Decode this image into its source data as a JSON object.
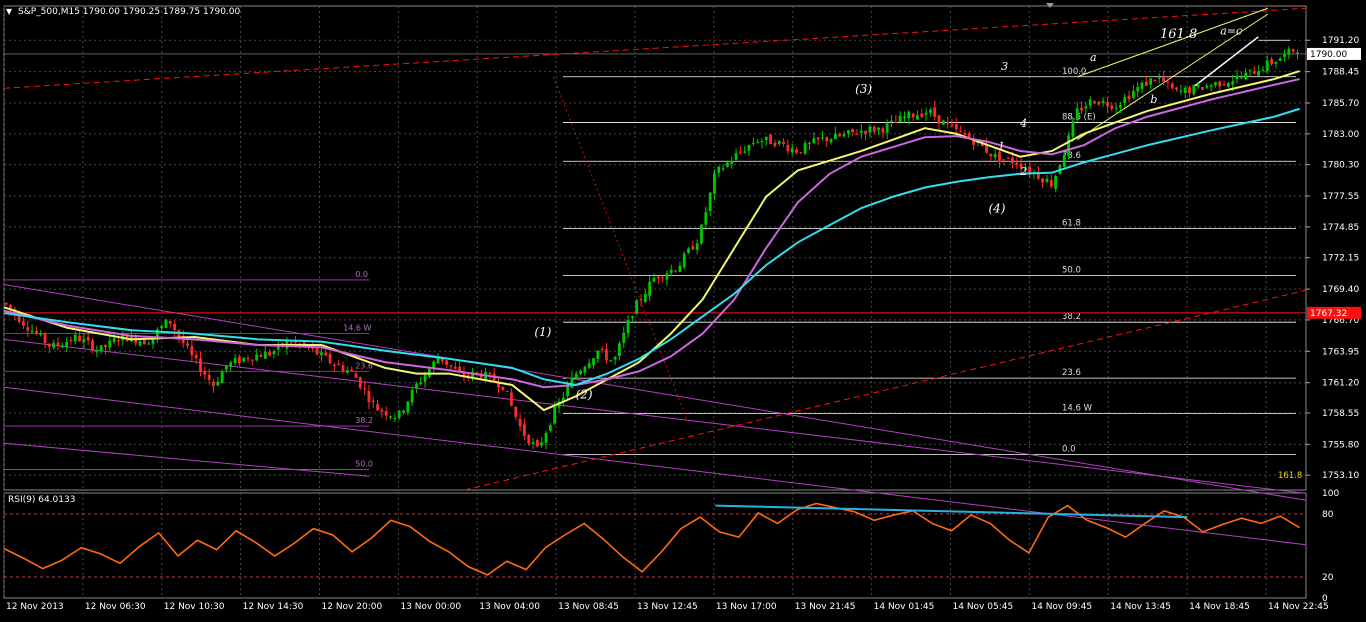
{
  "window": {
    "header_text": "S&P_500,M15  1790.00 1790.25 1789.75 1790.00",
    "rsi_header": "RSI(9) 64.0133"
  },
  "chart_data": {
    "type": "line",
    "instrument": "S&P_500",
    "timeframe": "M15",
    "ohlc": {
      "open": 1790.0,
      "high": 1790.25,
      "low": 1789.75,
      "close": 1790.0
    },
    "current_price": 1790.0,
    "horizontal_line_price": 1767.32,
    "ylim": [
      1751.8,
      1794.2
    ],
    "y_ticks": [
      1791.2,
      1788.45,
      1785.7,
      1783.0,
      1780.3,
      1777.55,
      1774.85,
      1772.15,
      1769.4,
      1766.7,
      1763.95,
      1761.2,
      1758.55,
      1755.8,
      1753.1
    ],
    "x_ticks": [
      "12 Nov 2013",
      "12 Nov 06:30",
      "12 Nov 10:30",
      "12 Nov 14:30",
      "12 Nov 20:00",
      "13 Nov 00:00",
      "13 Nov 04:00",
      "13 Nov 08:45",
      "13 Nov 12:45",
      "13 Nov 17:00",
      "13 Nov 21:45",
      "14 Nov 01:45",
      "14 Nov 05:45",
      "14 Nov 09:45",
      "14 Nov 13:45",
      "14 Nov 18:45",
      "14 Nov 22:45"
    ],
    "series": [
      {
        "name": "price",
        "points": [
          [
            0,
            1768.2
          ],
          [
            0.6,
            1766.5
          ],
          [
            1.5,
            1764.3
          ],
          [
            2.3,
            1765.2
          ],
          [
            3,
            1764.0
          ],
          [
            3.7,
            1765.3
          ],
          [
            4.5,
            1764.8
          ],
          [
            5.2,
            1766.7
          ],
          [
            5.9,
            1763.5
          ],
          [
            6.6,
            1761.0
          ],
          [
            7,
            1762.7
          ],
          [
            7.7,
            1763.5
          ],
          [
            8.4,
            1763.8
          ],
          [
            9,
            1764.8
          ],
          [
            9.6,
            1764.2
          ],
          [
            10.3,
            1763.0
          ],
          [
            11,
            1762.0
          ],
          [
            11.7,
            1759.0
          ],
          [
            12.4,
            1758.2
          ],
          [
            13,
            1761.0
          ],
          [
            13.7,
            1763.5
          ],
          [
            14.4,
            1761.8
          ],
          [
            15,
            1762.0
          ],
          [
            15.7,
            1761.0
          ],
          [
            16.3,
            1757.0
          ],
          [
            16.8,
            1755.3
          ],
          [
            17.3,
            1758.5
          ],
          [
            18,
            1762.0
          ],
          [
            18.7,
            1764.0
          ],
          [
            19.2,
            1763.0
          ],
          [
            19.8,
            1767.5
          ],
          [
            20.5,
            1770.5
          ],
          [
            21.2,
            1771.3
          ],
          [
            21.9,
            1774.0
          ],
          [
            22.4,
            1779.5
          ],
          [
            23,
            1781.0
          ],
          [
            23.7,
            1782.5
          ],
          [
            24.3,
            1782.3
          ],
          [
            25,
            1781.5
          ],
          [
            25.7,
            1782.5
          ],
          [
            26.4,
            1782.8
          ],
          [
            27,
            1783.3
          ],
          [
            27.7,
            1783.5
          ],
          [
            28.4,
            1784.5
          ],
          [
            29.1,
            1785.0
          ],
          [
            29.8,
            1783.5
          ],
          [
            30.5,
            1782.5
          ],
          [
            31.2,
            1781.0
          ],
          [
            31.9,
            1780.5
          ],
          [
            32.5,
            1779.5
          ],
          [
            33.0,
            1778.6
          ],
          [
            33.4,
            1781.5
          ],
          [
            33.8,
            1785.0
          ],
          [
            34.3,
            1786.0
          ],
          [
            35,
            1785.5
          ],
          [
            35.7,
            1787.0
          ],
          [
            36.3,
            1788.0
          ],
          [
            36.9,
            1786.6
          ],
          [
            37.6,
            1787.0
          ],
          [
            38.3,
            1787.5
          ],
          [
            39,
            1788.0
          ],
          [
            39.7,
            1789.0
          ],
          [
            40.3,
            1789.8
          ],
          [
            40.7,
            1790.5
          ]
        ]
      },
      {
        "name": "MA fast (yellow)",
        "points": [
          [
            0,
            1767.8
          ],
          [
            2,
            1766.0
          ],
          [
            4,
            1765.0
          ],
          [
            6,
            1765.2
          ],
          [
            8,
            1764.5
          ],
          [
            10,
            1764.5
          ],
          [
            12,
            1762.5
          ],
          [
            13,
            1762.0
          ],
          [
            14,
            1762.0
          ],
          [
            16,
            1761.0
          ],
          [
            17,
            1758.8
          ],
          [
            18,
            1760.0
          ],
          [
            19,
            1761.5
          ],
          [
            20,
            1763.0
          ],
          [
            21,
            1765.5
          ],
          [
            22,
            1768.5
          ],
          [
            23,
            1773.0
          ],
          [
            24,
            1777.5
          ],
          [
            25,
            1779.8
          ],
          [
            27,
            1781.5
          ],
          [
            29,
            1783.5
          ],
          [
            30,
            1783.0
          ],
          [
            31,
            1782.0
          ],
          [
            32,
            1781.0
          ],
          [
            33,
            1781.5
          ],
          [
            34,
            1783.0
          ],
          [
            36,
            1785.0
          ],
          [
            38,
            1786.5
          ],
          [
            40,
            1787.8
          ],
          [
            40.8,
            1788.5
          ]
        ]
      },
      {
        "name": "MA mid (violet)",
        "points": [
          [
            0,
            1767.5
          ],
          [
            2,
            1766.2
          ],
          [
            4,
            1765.3
          ],
          [
            6,
            1765.0
          ],
          [
            8,
            1764.5
          ],
          [
            10,
            1764.3
          ],
          [
            12,
            1763.0
          ],
          [
            14,
            1762.3
          ],
          [
            16,
            1761.5
          ],
          [
            17,
            1760.8
          ],
          [
            18,
            1761.0
          ],
          [
            19,
            1761.5
          ],
          [
            20,
            1762.2
          ],
          [
            21,
            1763.5
          ],
          [
            22,
            1765.5
          ],
          [
            23,
            1768.5
          ],
          [
            24,
            1773.0
          ],
          [
            25,
            1777.0
          ],
          [
            26,
            1779.5
          ],
          [
            27,
            1781.0
          ],
          [
            29,
            1782.7
          ],
          [
            30,
            1782.8
          ],
          [
            31,
            1782.3
          ],
          [
            32,
            1781.5
          ],
          [
            33,
            1781.2
          ],
          [
            34,
            1782.0
          ],
          [
            35,
            1783.5
          ],
          [
            36,
            1784.5
          ],
          [
            38,
            1786.0
          ],
          [
            40,
            1787.3
          ],
          [
            40.8,
            1787.8
          ]
        ]
      },
      {
        "name": "MA slow (cyan)",
        "points": [
          [
            0,
            1767.3
          ],
          [
            2,
            1766.5
          ],
          [
            4,
            1765.8
          ],
          [
            6,
            1765.5
          ],
          [
            8,
            1765.0
          ],
          [
            10,
            1764.8
          ],
          [
            12,
            1764.0
          ],
          [
            14,
            1763.3
          ],
          [
            16,
            1762.5
          ],
          [
            17,
            1761.5
          ],
          [
            18,
            1761.0
          ],
          [
            19,
            1762.0
          ],
          [
            20,
            1763.3
          ],
          [
            21,
            1765.0
          ],
          [
            22,
            1767.0
          ],
          [
            23,
            1769.0
          ],
          [
            24,
            1771.5
          ],
          [
            25,
            1773.5
          ],
          [
            26,
            1775.0
          ],
          [
            27,
            1776.5
          ],
          [
            28,
            1777.5
          ],
          [
            29,
            1778.3
          ],
          [
            30,
            1778.8
          ],
          [
            31,
            1779.2
          ],
          [
            32,
            1779.5
          ],
          [
            33,
            1779.6
          ],
          [
            34,
            1780.5
          ],
          [
            36,
            1782.0
          ],
          [
            38,
            1783.3
          ],
          [
            40,
            1784.5
          ],
          [
            40.8,
            1785.2
          ]
        ]
      }
    ],
    "fibonacci_levels": [
      {
        "label": "100.0",
        "price": 1788.0
      },
      {
        "label": "88.6 (E)",
        "price": 1784.0
      },
      {
        "label": "78.6",
        "price": 1780.6
      },
      {
        "label": "61.8",
        "price": 1774.7
      },
      {
        "label": "50.0",
        "price": 1770.6
      },
      {
        "label": "38.2",
        "price": 1766.5
      },
      {
        "label": "23.6",
        "price": 1761.6
      },
      {
        "label": "14.6 W",
        "price": 1758.5
      },
      {
        "label": "0.0",
        "price": 1754.9
      }
    ],
    "left_fib_labels": [
      "0.0",
      "14.6 W",
      "23.6",
      "38.2",
      "50.0"
    ],
    "right_labels": [
      "161.8",
      "161.8"
    ],
    "wave_labels": [
      "(1)",
      "(2)",
      "(3)",
      "(4)",
      "1",
      "2",
      "3",
      "4",
      "a",
      "b",
      "a=c"
    ],
    "rsi": {
      "period": 9,
      "value": 64.0133,
      "ticks": [
        "100",
        "80",
        "20",
        "0"
      ],
      "levels": [
        80,
        20
      ],
      "values": [
        47,
        38,
        28,
        36,
        48,
        42,
        33,
        49,
        62,
        40,
        55,
        46,
        64,
        53,
        40,
        52,
        66,
        60,
        44,
        57,
        74,
        68,
        54,
        44,
        30,
        22,
        35,
        27,
        48,
        60,
        71,
        56,
        39,
        25,
        44,
        66,
        77,
        63,
        58,
        81,
        71,
        84,
        90,
        86,
        82,
        74,
        79,
        83,
        71,
        64,
        79,
        71,
        55,
        43,
        77,
        88,
        74,
        67,
        58,
        71,
        83,
        77,
        63,
        70,
        76,
        71,
        78,
        67
      ],
      "divergence_start": 88,
      "divergence_end": 77
    },
    "colors": {
      "background": "#000000",
      "grid": "#4a4a4a",
      "up_candle": "#00c800",
      "down_candle": "#ff2a2a",
      "ma_fast": "#f2f56e",
      "ma_mid": "#cc66dd",
      "ma_slow": "#33ddee",
      "fib": "#ffffff",
      "channel": "#b040c0",
      "price_line": "#ff1010",
      "rsi": "#ff6a10",
      "rsi_divergence": "#2ab0e0",
      "axis_text": "#ffffff"
    }
  }
}
